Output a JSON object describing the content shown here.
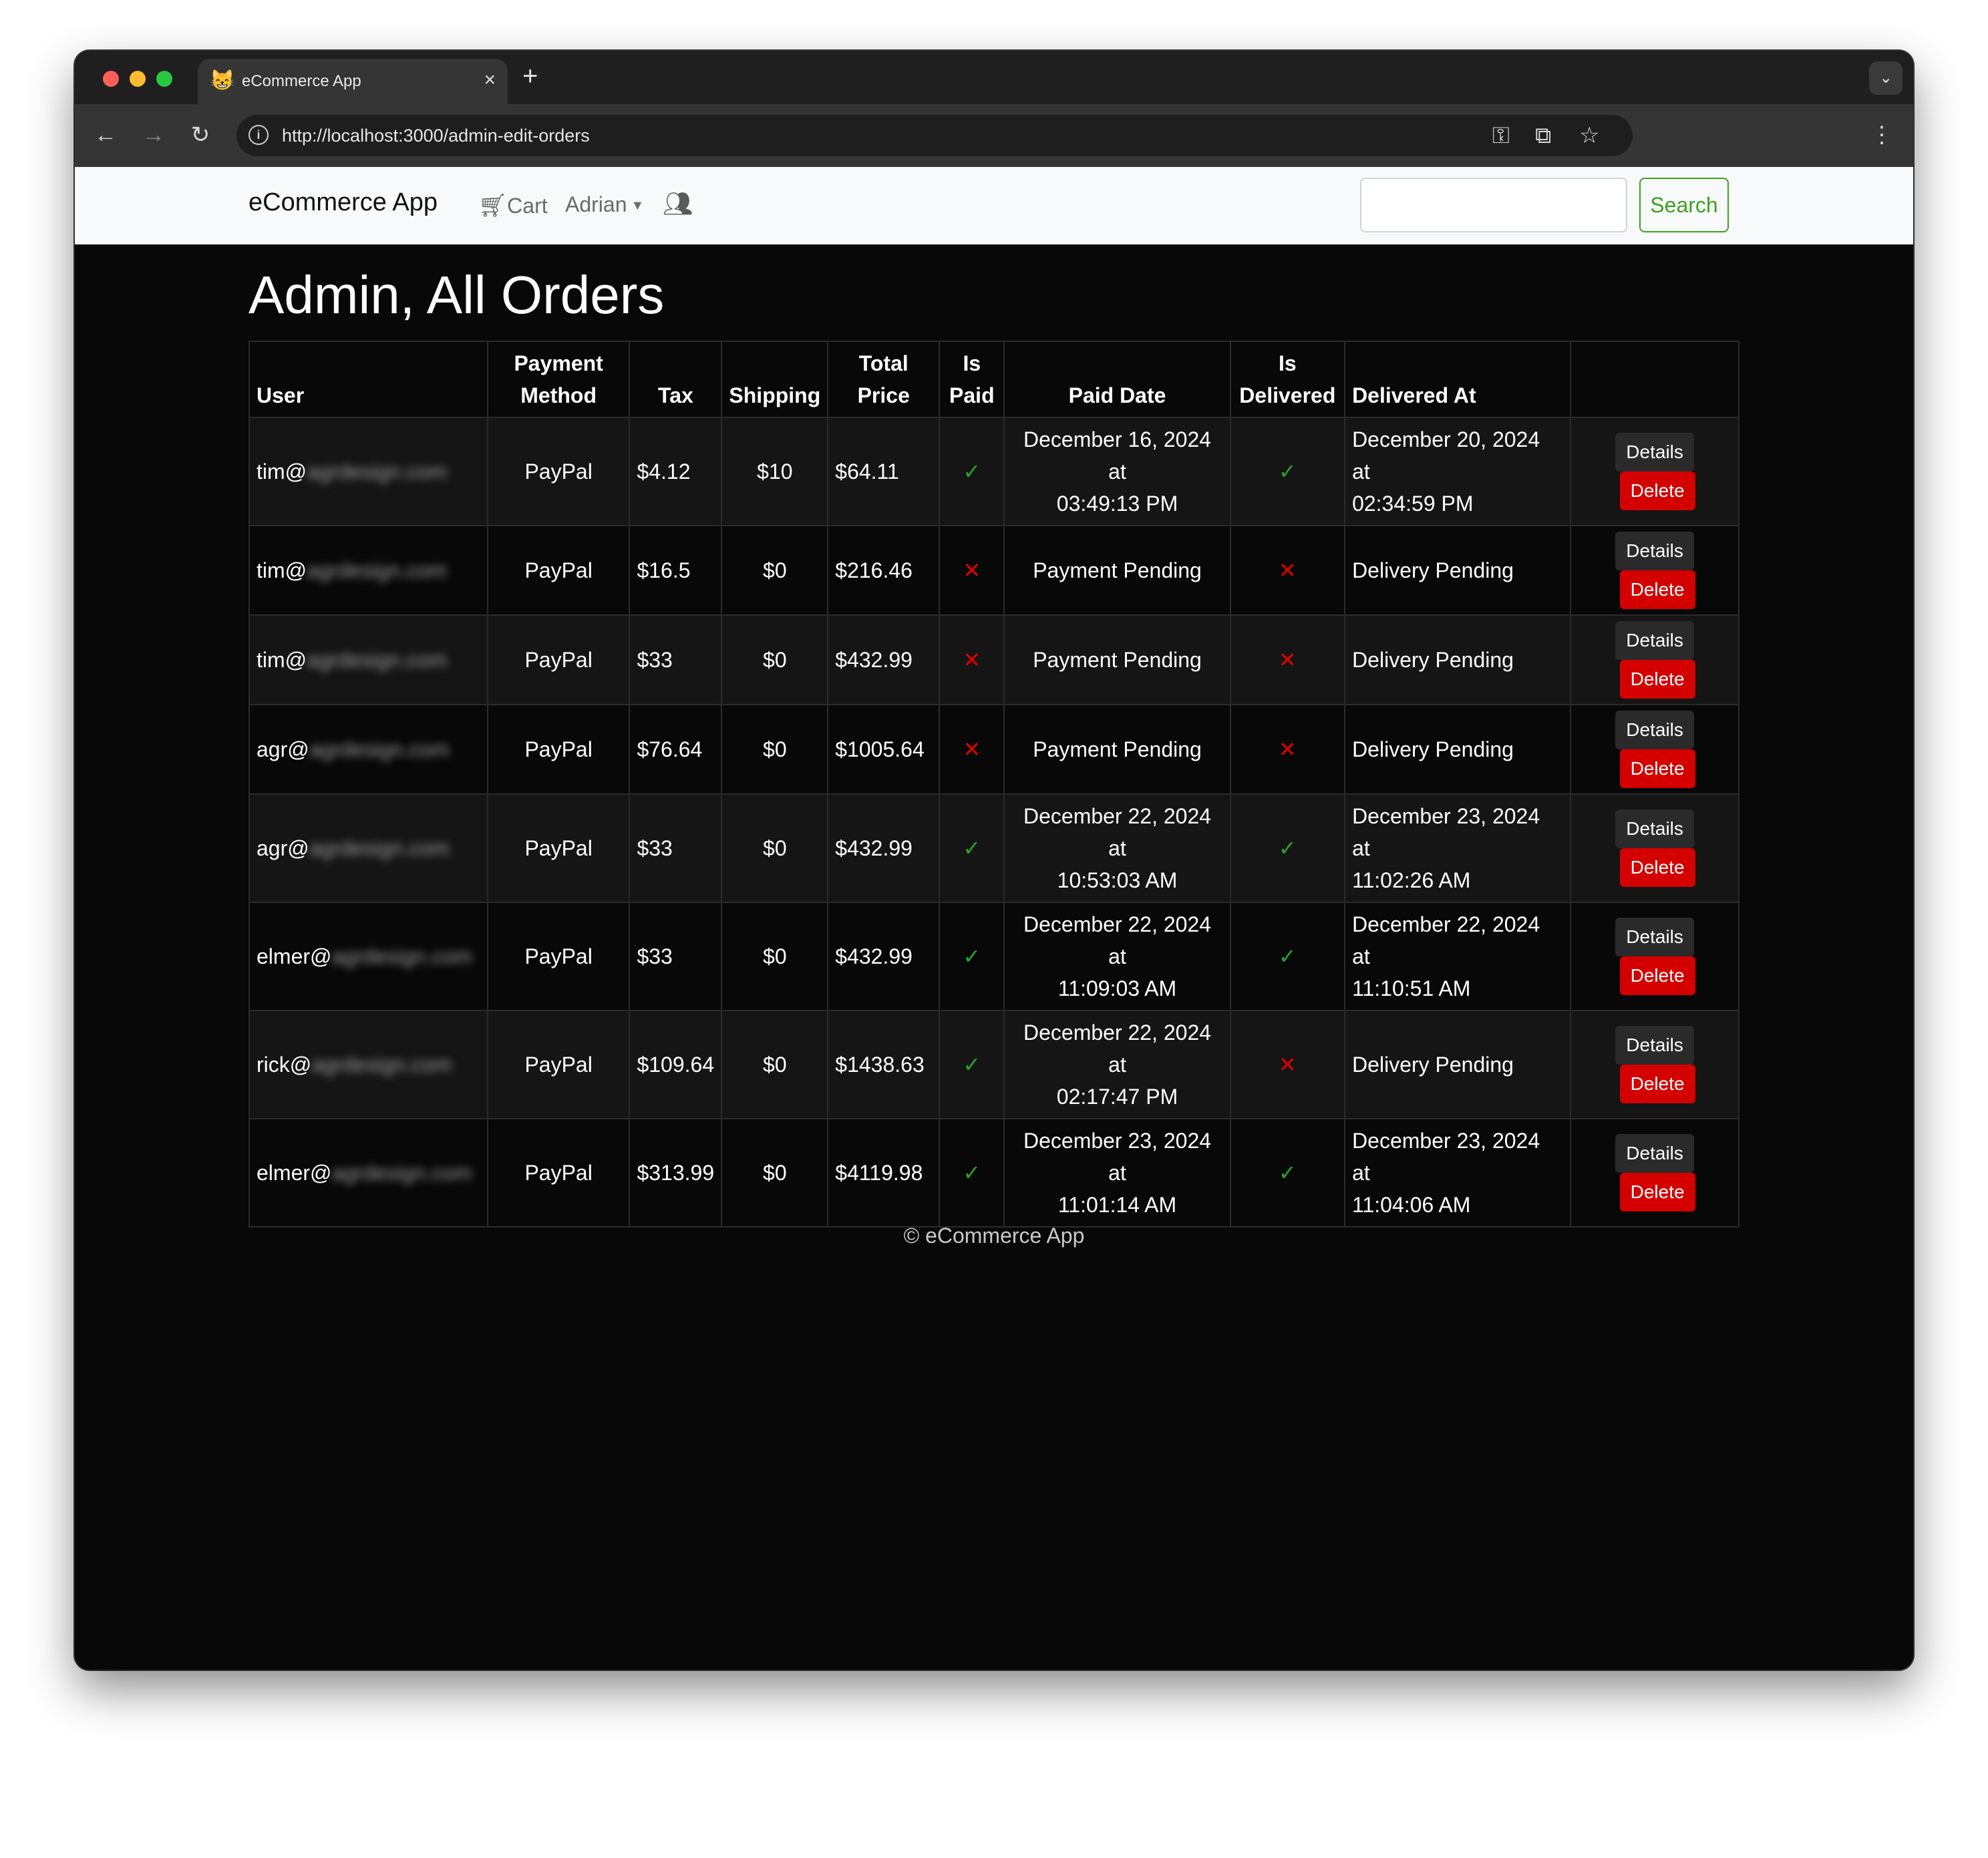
{
  "browser": {
    "tab_title": "eCommerce App",
    "tab_favicon": "😸",
    "url": "http://localhost:3000/admin-edit-orders"
  },
  "navbar": {
    "brand": "eCommerce App",
    "cart_label": "Cart",
    "user_label": "Adrian",
    "search_placeholder": "",
    "search_button": "Search"
  },
  "page_title": "Admin, All Orders",
  "table": {
    "headers": {
      "user": "User",
      "payment_method": [
        "Payment",
        "Method"
      ],
      "tax": "Tax",
      "shipping": "Shipping",
      "total_price": [
        "Total",
        "Price"
      ],
      "is_paid": [
        "Is",
        "Paid"
      ],
      "paid_date": "Paid Date",
      "is_delivered": [
        "Is",
        "Delivered"
      ],
      "delivered_at": "Delivered At"
    },
    "rows": [
      {
        "user_prefix": "tim@",
        "user_blur": "agrdesign.com",
        "payment": "PayPal",
        "tax": "$4.12",
        "shipping": "$10",
        "total": "$64.11",
        "paid": true,
        "paid_date": [
          "December 16, 2024 at",
          "03:49:13 PM"
        ],
        "delivered": true,
        "delivered_at": [
          "December 20, 2024 at",
          "02:34:59 PM"
        ]
      },
      {
        "user_prefix": "tim@",
        "user_blur": "agrdesign.com",
        "payment": "PayPal",
        "tax": "$16.5",
        "shipping": "$0",
        "total": "$216.46",
        "paid": false,
        "paid_date": [
          "Payment Pending"
        ],
        "delivered": false,
        "delivered_at": [
          "Delivery Pending"
        ]
      },
      {
        "user_prefix": "tim@",
        "user_blur": "agrdesign.com",
        "payment": "PayPal",
        "tax": "$33",
        "shipping": "$0",
        "total": "$432.99",
        "paid": false,
        "paid_date": [
          "Payment Pending"
        ],
        "delivered": false,
        "delivered_at": [
          "Delivery Pending"
        ]
      },
      {
        "user_prefix": "agr@",
        "user_blur": "agrdesign.com",
        "payment": "PayPal",
        "tax": "$76.64",
        "shipping": "$0",
        "total": "$1005.64",
        "paid": false,
        "paid_date": [
          "Payment Pending"
        ],
        "delivered": false,
        "delivered_at": [
          "Delivery Pending"
        ]
      },
      {
        "user_prefix": "agr@",
        "user_blur": "agrdesign.com",
        "payment": "PayPal",
        "tax": "$33",
        "shipping": "$0",
        "total": "$432.99",
        "paid": true,
        "paid_date": [
          "December 22, 2024 at",
          "10:53:03 AM"
        ],
        "delivered": true,
        "delivered_at": [
          "December 23, 2024 at",
          "11:02:26 AM"
        ]
      },
      {
        "user_prefix": "elmer@",
        "user_blur": "agrdesign.com",
        "payment": "PayPal",
        "tax": "$33",
        "shipping": "$0",
        "total": "$432.99",
        "paid": true,
        "paid_date": [
          "December 22, 2024 at",
          "11:09:03 AM"
        ],
        "delivered": true,
        "delivered_at": [
          "December 22, 2024 at",
          "11:10:51 AM"
        ]
      },
      {
        "user_prefix": "rick@",
        "user_blur": "agrdesign.com",
        "payment": "PayPal",
        "tax": "$109.64",
        "shipping": "$0",
        "total": "$1438.63",
        "paid": true,
        "paid_date": [
          "December 22, 2024 at",
          "02:17:47 PM"
        ],
        "delivered": false,
        "delivered_at": [
          "Delivery Pending"
        ]
      },
      {
        "user_prefix": "elmer@",
        "user_blur": "agrdesign.com",
        "payment": "PayPal",
        "tax": "$313.99",
        "shipping": "$0",
        "total": "$4119.98",
        "paid": true,
        "paid_date": [
          "December 23, 2024 at",
          "11:01:14 AM"
        ],
        "delivered": true,
        "delivered_at": [
          "December 23, 2024 at",
          "11:04:06 AM"
        ]
      }
    ],
    "details_label": "Details",
    "delete_label": "Delete",
    "check_glyph": "✓",
    "cross_glyph": "✕"
  },
  "footer": "© eCommerce App",
  "colors": {
    "page_bg": "#080808",
    "navbar_bg": "#f8f9fa",
    "search_accent": "#3ea31f",
    "delete_red": "#d40000",
    "check_green": "#2aa12a",
    "cross_red": "#e00000"
  }
}
